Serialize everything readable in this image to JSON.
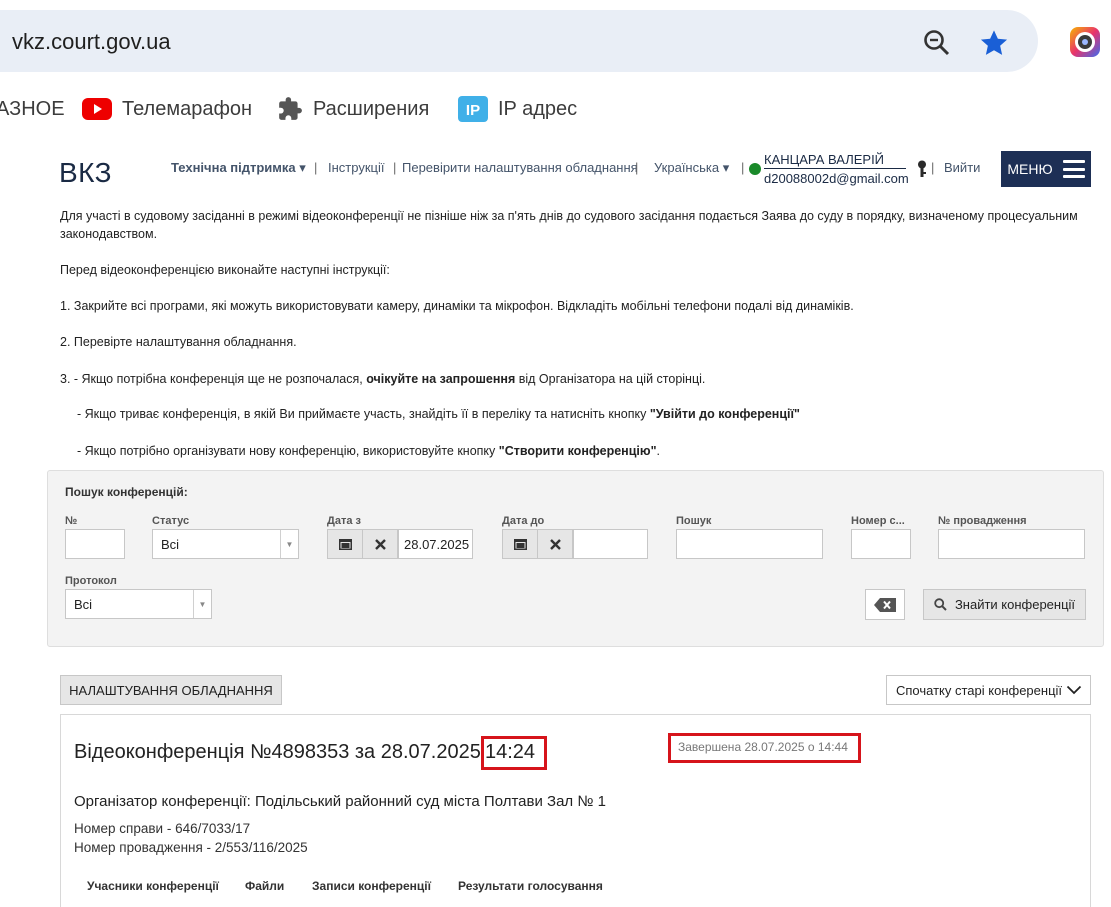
{
  "browser": {
    "url": "vkz.court.gov.ua",
    "bookmarks": [
      {
        "label": "АЗНОЕ"
      },
      {
        "label": "Телемарафон"
      },
      {
        "label": "Расширения"
      },
      {
        "label": "IP адрес"
      }
    ]
  },
  "header": {
    "logo": "ВКЗ",
    "nav": {
      "support": "Технічна підтримка ▾",
      "instructions": "Інструкції",
      "check_equipment": "Перевірити налаштування обладнання",
      "language": "Українська ▾"
    },
    "user": {
      "name": "КАНЦАРА ВАЛЕРІЙ",
      "email": "d20088002d@gmail.com"
    },
    "logout": "Вийти",
    "menu": "МЕНЮ"
  },
  "instructions": {
    "p1_line1": "Для участі в судовому засіданні в режимі відеоконференції не пізніше ніж за п'ять днів до судового засідання подається Заява до суду в порядку, визначеному процесуальним",
    "p1_line2": "законодавством.",
    "p2": "Перед відеоконференцією виконайте наступні інструкції:",
    "step1": "1. Закрийте всі програми, які можуть використовувати камеру, динаміки та мікрофон. Відкладіть мобільні телефони подалі від динаміків.",
    "step2": "2. Перевірте налаштування обладнання.",
    "step3_a_pre": "3.  - Якщо потрібна конференція ще не розпочалася, ",
    "step3_a_bold": "очікуйте на запрошення",
    "step3_a_post": " від Організатора на цій сторінці.",
    "step3_b_pre": "- Якщо триває конференція, в якій Ви приймаєте участь, знайдіть її в переліку та натисніть кнопку ",
    "step3_b_bold": "\"Увійти до конференції\"",
    "step3_c_pre": "- Якщо потрібно організувати нову конференцію, використовуйте кнопку ",
    "step3_c_bold": "\"Створити конференцію\"",
    "step3_c_post": "."
  },
  "search": {
    "title": "Пошук конференцій:",
    "labels": {
      "number": "№",
      "status": "Статус",
      "date_from": "Дата з",
      "date_to": "Дата до",
      "query": "Пошук",
      "case_no": "Номер с...",
      "proceeding_no": "№ провадження",
      "protocol": "Протокол"
    },
    "values": {
      "status": "Всі",
      "date_from": "28.07.2025",
      "protocol": "Всі"
    },
    "find_button": "Знайти конференції"
  },
  "toolbar": {
    "settings_button": "НАЛАШТУВАННЯ ОБЛАДНАННЯ",
    "sort": "Спочатку старі конференції"
  },
  "conference": {
    "title": "Відеоконференція №4898353 за 28.07.2025",
    "time": "14:24",
    "status": "Завершена 28.07.2025 о 14:44",
    "organizer": "Організатор конференції: Подільський районний суд міста Полтави Зал № 1",
    "case_number": "Номер справи - 646/7033/17",
    "proceeding_number": "Номер провадження - 2/553/116/2025",
    "tabs": [
      "Учасники конференції",
      "Файли",
      "Записи конференції",
      "Результати голосування"
    ]
  },
  "colors": {
    "highlight": "#d6141b",
    "menu_bg": "#1d2f55",
    "status_online": "#1a8a2a"
  }
}
